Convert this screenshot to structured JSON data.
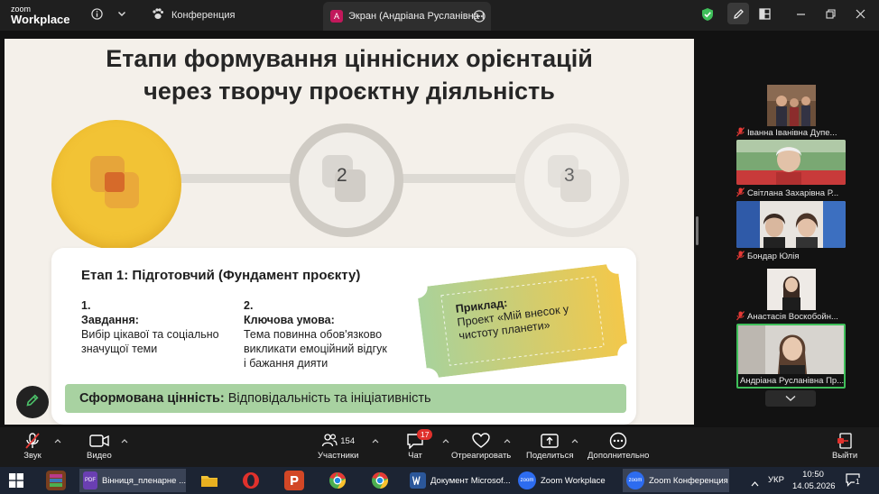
{
  "titlebar": {
    "brand_top": "zoom",
    "brand_bottom": "Workplace",
    "conference_tab": "Конференция",
    "screen_tab_avatar": "A",
    "screen_tab": "Экран (Андріана Русланівна Прс"
  },
  "slide": {
    "title_line1": "Етапи формування ціннісних орієнтацій",
    "title_line2": "через творчу проєктну діяльність",
    "step2": "2",
    "step3": "3",
    "stage_heading": "Етап 1: Підготовчий (Фундамент проєкту)",
    "col1_num": "1.",
    "col1_head": "Завдання:",
    "col1_line1": "Вибір цікавої та соціально",
    "col1_line2": "значущої теми",
    "col2_num": "2.",
    "col2_head": "Ключова умова:",
    "col2_line1": "Тема повинна обов'язково",
    "col2_line2": "викликати емоційний відгук",
    "col2_line3": "і бажання дияти",
    "ticket_head": "Приклад:",
    "ticket_line1": "Проект «Мій внесок у",
    "ticket_line2": "чистоту планети»",
    "value_label": "Сформована цінність:",
    "value_text": "Відповідальність та ініціативність"
  },
  "participants": [
    {
      "name": "Іванна Іванівна Дупе..."
    },
    {
      "name": "Світлана Захарівна Р..."
    },
    {
      "name": "Бондар Юлія"
    },
    {
      "name": "Анастасія Воскобойн..."
    },
    {
      "name": "Андріана Русланівна Пр..."
    }
  ],
  "toolbar": {
    "audio": "Звук",
    "video": "Видео",
    "participants_count": "154",
    "participants": "Участники",
    "chat_badge": "17",
    "chat": "Чат",
    "react": "Отреагировать",
    "share": "Поделиться",
    "more": "Дополнительно",
    "leave": "Выйти"
  },
  "taskbar": {
    "pdf_badge": "PDF",
    "pdf_app": "Вінниця_пленарне ...",
    "word_doc": "Документ Microsof...",
    "zoom_badge": "zoom",
    "zoom_workplace": "Zoom Workplace",
    "zoom_conf": "Zoom Конференция",
    "lang": "УКР",
    "time": "10:50",
    "date": "14.05.2026",
    "notif": "1"
  },
  "colors": {
    "accent_yellow": "#f2c335",
    "value_green": "#a8d2a1",
    "leave_red": "#e0312c",
    "zoom_blue": "#2d6cf0"
  }
}
